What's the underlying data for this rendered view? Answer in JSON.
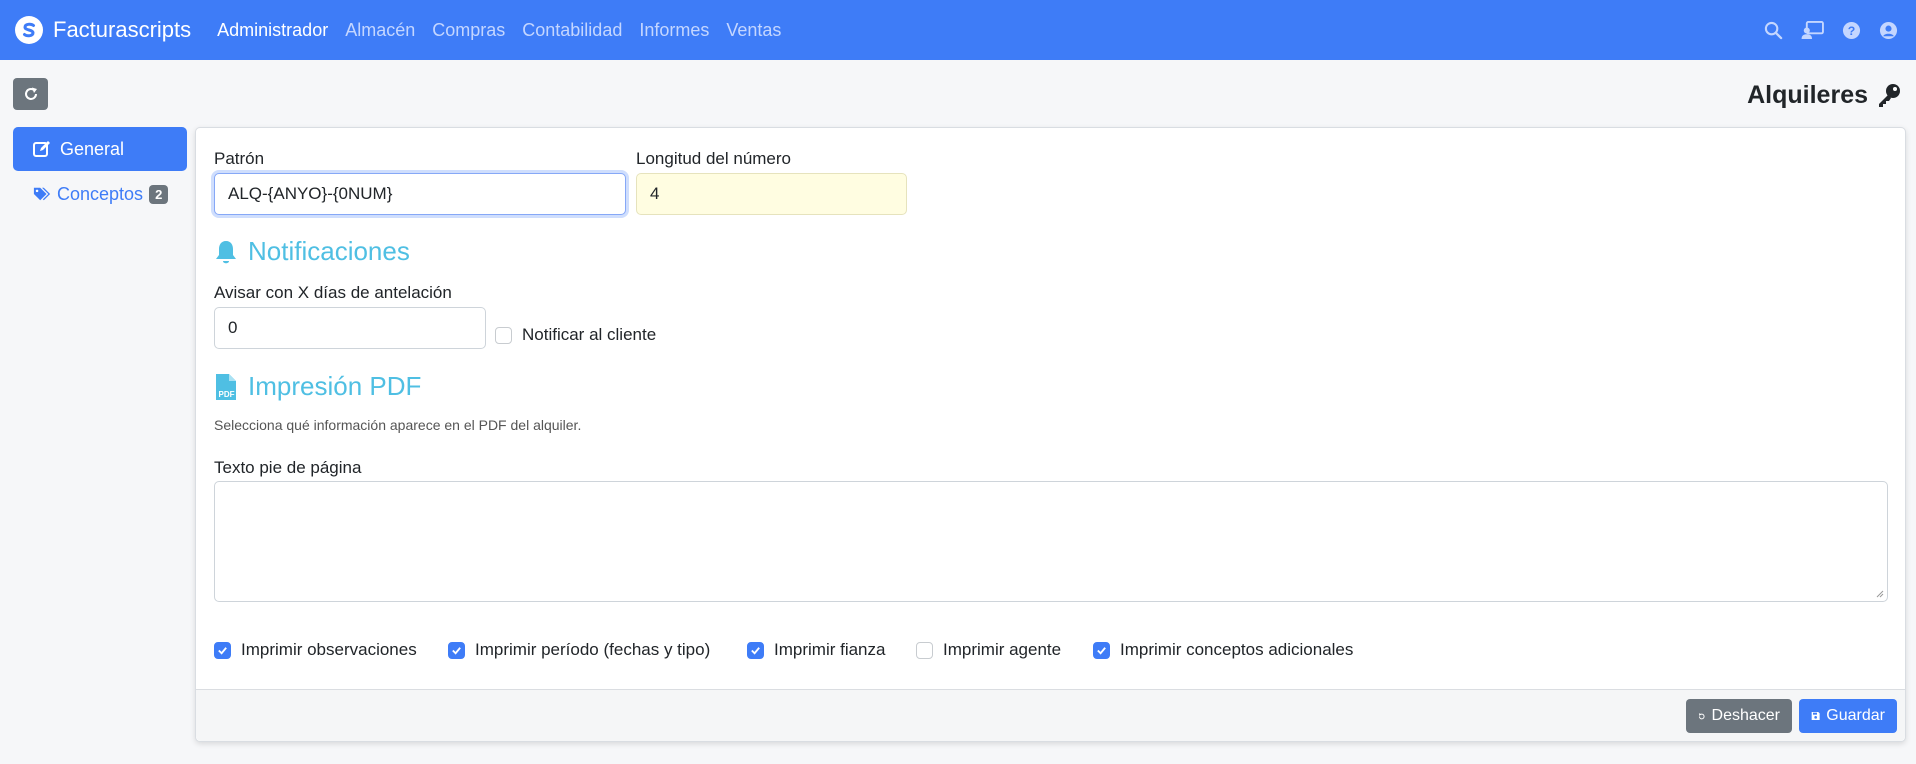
{
  "navbar": {
    "brand": "Facturascripts",
    "menu": [
      {
        "label": "Administrador",
        "active": true
      },
      {
        "label": "Almacén",
        "active": false
      },
      {
        "label": "Compras",
        "active": false
      },
      {
        "label": "Contabilidad",
        "active": false
      },
      {
        "label": "Informes",
        "active": false
      },
      {
        "label": "Ventas",
        "active": false
      }
    ],
    "icons": [
      "search-icon",
      "chat-users-icon",
      "help-icon",
      "user-icon"
    ]
  },
  "page": {
    "title": "Alquileres",
    "title_icon": "key-icon"
  },
  "sidebar": {
    "items": [
      {
        "label": "General",
        "icon": "edit-icon",
        "active": true
      },
      {
        "label": "Conceptos",
        "icon": "tags-icon",
        "badge": "2",
        "active": false
      }
    ]
  },
  "form": {
    "patron": {
      "label": "Patrón",
      "value": "ALQ-{ANYO}-{0NUM}"
    },
    "longitud": {
      "label": "Longitud del número",
      "value": "4"
    },
    "notificaciones": {
      "title": "Notificaciones",
      "dias_label": "Avisar con X días de antelación",
      "dias_value": "0",
      "notificar_cliente": {
        "label": "Notificar al cliente",
        "checked": false
      }
    },
    "pdf": {
      "title": "Impresión PDF",
      "help": "Selecciona qué información aparece en el PDF del alquiler.",
      "footer_label": "Texto pie de página",
      "footer_value": "",
      "options": [
        {
          "label": "Imprimir observaciones",
          "checked": true
        },
        {
          "label": "Imprimir período (fechas y tipo)",
          "checked": true
        },
        {
          "label": "Imprimir fianza",
          "checked": true
        },
        {
          "label": "Imprimir agente",
          "checked": false
        },
        {
          "label": "Imprimir conceptos adicionales",
          "checked": true
        }
      ]
    }
  },
  "footer": {
    "undo_label": "Deshacer",
    "save_label": "Guardar"
  },
  "colors": {
    "primary": "#3e7cf7",
    "secondary": "#6c757d",
    "section_title": "#4fbfe3"
  }
}
